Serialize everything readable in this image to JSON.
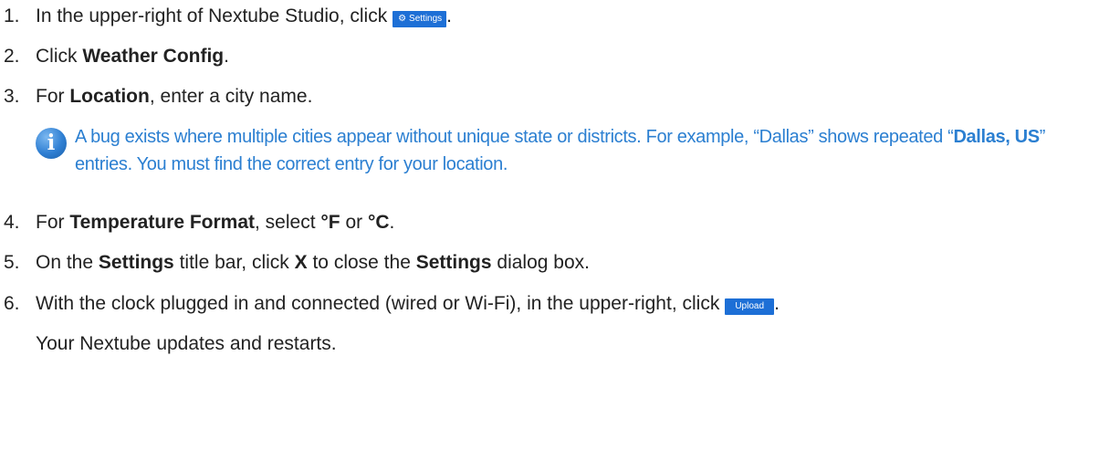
{
  "steps": [
    {
      "num": "1.",
      "text": "In the upper-right of Nextube Studio, click",
      "button_label": "Settings",
      "after": "."
    },
    {
      "num": "2.",
      "before": "Click ",
      "bold": "Weather Config",
      "after": "."
    },
    {
      "num": "3.",
      "before": "For ",
      "bold": "Location",
      "after": ", enter a city name."
    },
    {
      "num": "4.",
      "before": "For ",
      "bold": "Temperature Format",
      "mid": ", select ",
      "bold2": "°F",
      "mid2": " or ",
      "bold3": "°C",
      "after": "."
    },
    {
      "num": "5.",
      "before": "On the ",
      "bold": "Settings",
      "mid": " title bar, click ",
      "bold2": "X",
      "mid2": " to close the ",
      "bold3": "Settings",
      "after": " dialog box."
    },
    {
      "num": "6.",
      "text": "With the clock plugged in and connected (wired or Wi-Fi), in the upper-right, click",
      "button_label": "Upload",
      "after": "."
    }
  ],
  "note": {
    "part1": "A bug exists where multiple cities appear without unique state or districts. For example, “Dallas” shows repeated “",
    "bold": "Dallas, US",
    "part2": "” entries. You must find the correct entry for your location."
  },
  "follow_up": "Your Nextube updates and restarts.",
  "colors": {
    "note_text": "#2b7fd1",
    "button_bg": "#1d6fd6",
    "body_text": "#222222"
  },
  "icons": {
    "note_icon": "info-icon",
    "settings_icon": "gear-icon"
  }
}
